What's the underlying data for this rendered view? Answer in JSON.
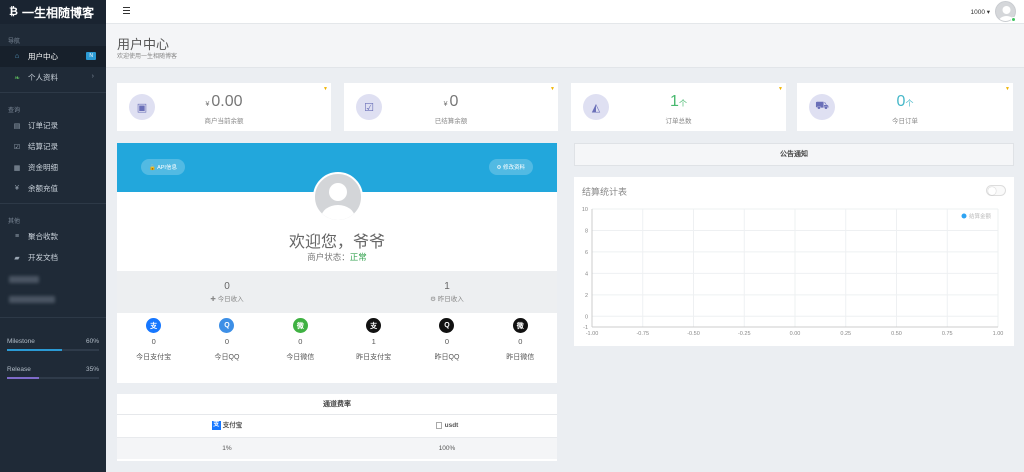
{
  "brand": {
    "icon": "₿",
    "name": "一生相随博客"
  },
  "sidebar": {
    "section_nav": "导航",
    "section_query": "查询",
    "section_other": "其他",
    "items": [
      {
        "label": "用户中心",
        "icon": "⌂",
        "badge": "N"
      },
      {
        "label": "个人资料",
        "icon": "❧",
        "arrow": "›"
      },
      {
        "label": "订单记录",
        "icon": "▤"
      },
      {
        "label": "结算记录",
        "icon": "☑"
      },
      {
        "label": "资金明细",
        "icon": "▦"
      },
      {
        "label": "余额充值",
        "icon": "¥"
      },
      {
        "label": "聚合收款",
        "icon": "≡"
      },
      {
        "label": "开发文档",
        "icon": "▰"
      }
    ],
    "progress": [
      {
        "label": "Milestone",
        "percent": "60%",
        "value": 0.6,
        "color": "#2b9ad4"
      },
      {
        "label": "Release",
        "percent": "35%",
        "value": 0.35,
        "color": "#7e6bc9"
      }
    ]
  },
  "topbar": {
    "user": "1000 ▾",
    "menu_icon": "hamburger-icon"
  },
  "header": {
    "title": "用户中心",
    "subtitle": "欢迎使用一生相随博客"
  },
  "stats": [
    {
      "currency": "¥",
      "value": "0.00",
      "unit": "",
      "label": "商户当前余额",
      "icon": "▣"
    },
    {
      "currency": "¥",
      "value": "0",
      "unit": "",
      "label": "已结算余额",
      "icon": "☑"
    },
    {
      "currency": "",
      "value": "1",
      "unit": "个",
      "label": "订单总数",
      "icon": "◭"
    },
    {
      "currency": "",
      "value": "0",
      "unit": "个",
      "label": "今日订单",
      "icon": "⛟"
    }
  ],
  "profile": {
    "api_button": "🔒 API信息",
    "edit_button": "⚙ 修改资料",
    "welcome": "欢迎您，爷爷",
    "status_label": "商户状态：",
    "status_value": "正常",
    "income": [
      {
        "value": "0",
        "label": "✚ 今日收入"
      },
      {
        "value": "1",
        "label": "⚙ 昨日收入"
      }
    ],
    "payments": [
      {
        "glyph": "支",
        "value": "0",
        "label": "今日支付宝",
        "color": "#1677ff"
      },
      {
        "glyph": "Q",
        "value": "0",
        "label": "今日QQ",
        "color": "#3d8fe6"
      },
      {
        "glyph": "微",
        "value": "0",
        "label": "今日微信",
        "color": "#3fb142"
      },
      {
        "glyph": "支",
        "value": "1",
        "label": "昨日支付宝",
        "color": "#111"
      },
      {
        "glyph": "Q",
        "value": "0",
        "label": "昨日QQ",
        "color": "#111"
      },
      {
        "glyph": "微",
        "value": "0",
        "label": "昨日微信",
        "color": "#111"
      }
    ]
  },
  "rate_table": {
    "title": "通道费率",
    "columns": [
      "支付宝",
      "usdt"
    ],
    "values": [
      "1%",
      "100%"
    ]
  },
  "notice": {
    "title": "公告通知"
  },
  "chart_data": {
    "type": "line",
    "title": "结算统计表",
    "series": [
      {
        "name": "结算金额",
        "values": []
      }
    ],
    "x": [],
    "xlim": [
      -1,
      1
    ],
    "ylim": [
      -1,
      10
    ],
    "x_ticks": [
      "-1.00",
      "-0.75",
      "-0.50",
      "-0.25",
      "0.00",
      "0.25",
      "0.50",
      "0.75",
      "1.00"
    ],
    "y_ticks": [
      "10",
      "8",
      "6",
      "4",
      "2",
      "0",
      "-1"
    ],
    "grid": true,
    "legend": "top-right",
    "series_color": "#2ea3f2"
  }
}
